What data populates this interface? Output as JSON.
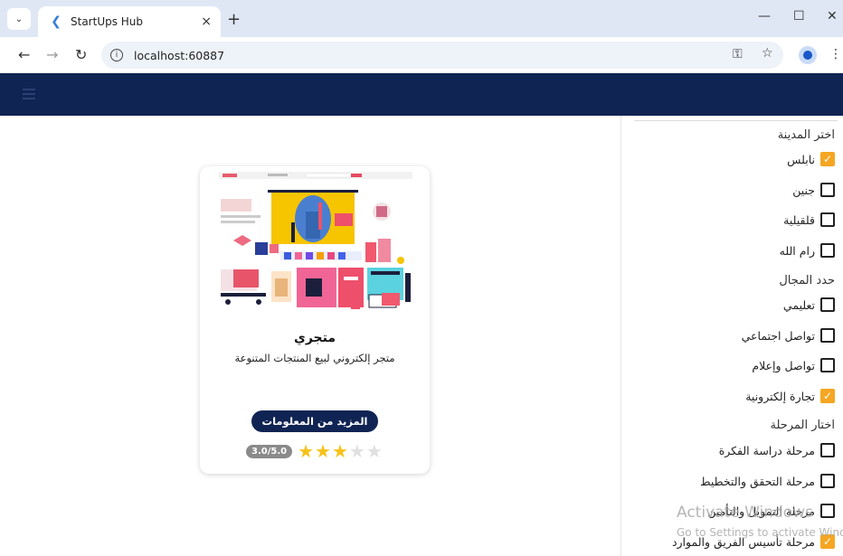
{
  "browser": {
    "tab_title": "StartUps Hub",
    "url": "localhost:60887",
    "new_tab_symbol": "+",
    "close_symbol": "×"
  },
  "sidebar": {
    "city_heading": "اختر المدينة",
    "cities": [
      {
        "label": "نابلس",
        "checked": true
      },
      {
        "label": "جنين",
        "checked": false
      },
      {
        "label": "قلقيلية",
        "checked": false
      },
      {
        "label": "رام الله",
        "checked": false
      }
    ],
    "field_heading": "حدد المجال",
    "fields": [
      {
        "label": "تعليمي",
        "checked": false
      },
      {
        "label": "تواصل اجتماعي",
        "checked": false
      },
      {
        "label": "تواصل وإعلام",
        "checked": false
      },
      {
        "label": "تجارة إلكترونية",
        "checked": true
      }
    ],
    "stage_heading": "اختار المرحلة",
    "stages": [
      {
        "label": "مرحلة دراسة الفكرة",
        "checked": false
      },
      {
        "label": "مرحلة التحقق والتخطيط",
        "checked": false
      },
      {
        "label": "مرحلة التمويل والتأمين",
        "checked": false
      },
      {
        "label": "مرحلة تأسيس الفريق والموارد",
        "checked": true
      }
    ]
  },
  "card": {
    "title": "متجري",
    "description": "متجر إلكتروني لبيع المنتجات المتنوعة",
    "button_label": "المزيد من المعلومات",
    "rating_text": "3.0/5.0",
    "rating_value": 3,
    "rating_max": 5
  },
  "watermark": {
    "line1": "Activate Windows",
    "line2": "Go to Settings to activate Windows."
  },
  "colors": {
    "header": "#102454",
    "accent": "#f5a623",
    "star": "#f6c21a"
  }
}
